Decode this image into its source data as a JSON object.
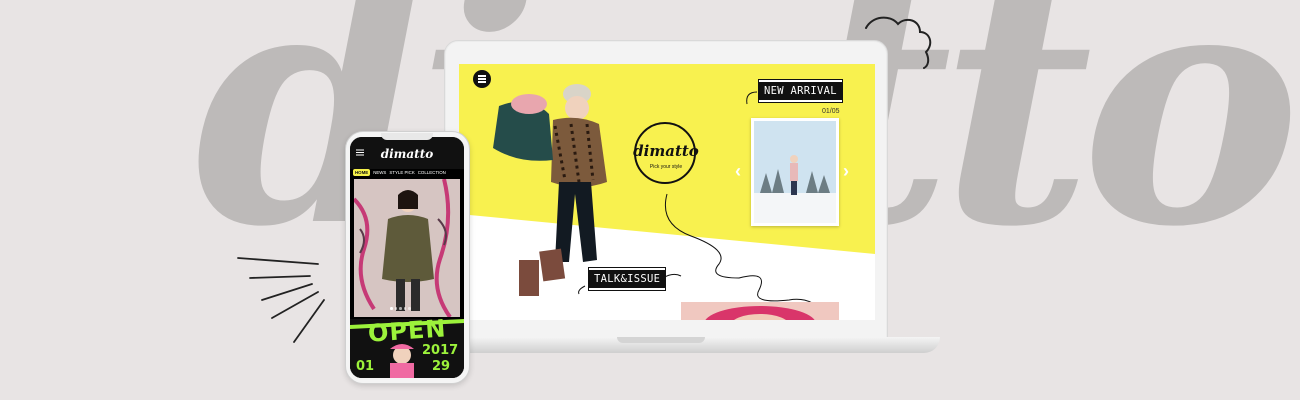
{
  "background": {
    "word_left": "di",
    "word_right": "tto",
    "color": "#bdbab9"
  },
  "desktop": {
    "menu_icon": "hamburger-icon",
    "new_arrival_label": "NEW ARRIVAL",
    "page_counter": "01/05",
    "logo_text": "dimatto",
    "logo_tagline": "Pick your style",
    "talk_issue_label": "TALK&ISSUE",
    "accent_color": "#f8f14f",
    "prev_icon": "chevron-left-icon",
    "next_icon": "chevron-right-icon"
  },
  "mobile": {
    "logo_text": "dimatto",
    "menu_icon": "hamburger-icon",
    "nav": [
      "HOME",
      "NEWS",
      "STYLE PICK",
      "COLLECTION"
    ],
    "banner_word": "OPEN",
    "banner_year": "2017",
    "banner_date_left": "01",
    "banner_date_right": "29",
    "accent_color": "#9cf23b"
  }
}
